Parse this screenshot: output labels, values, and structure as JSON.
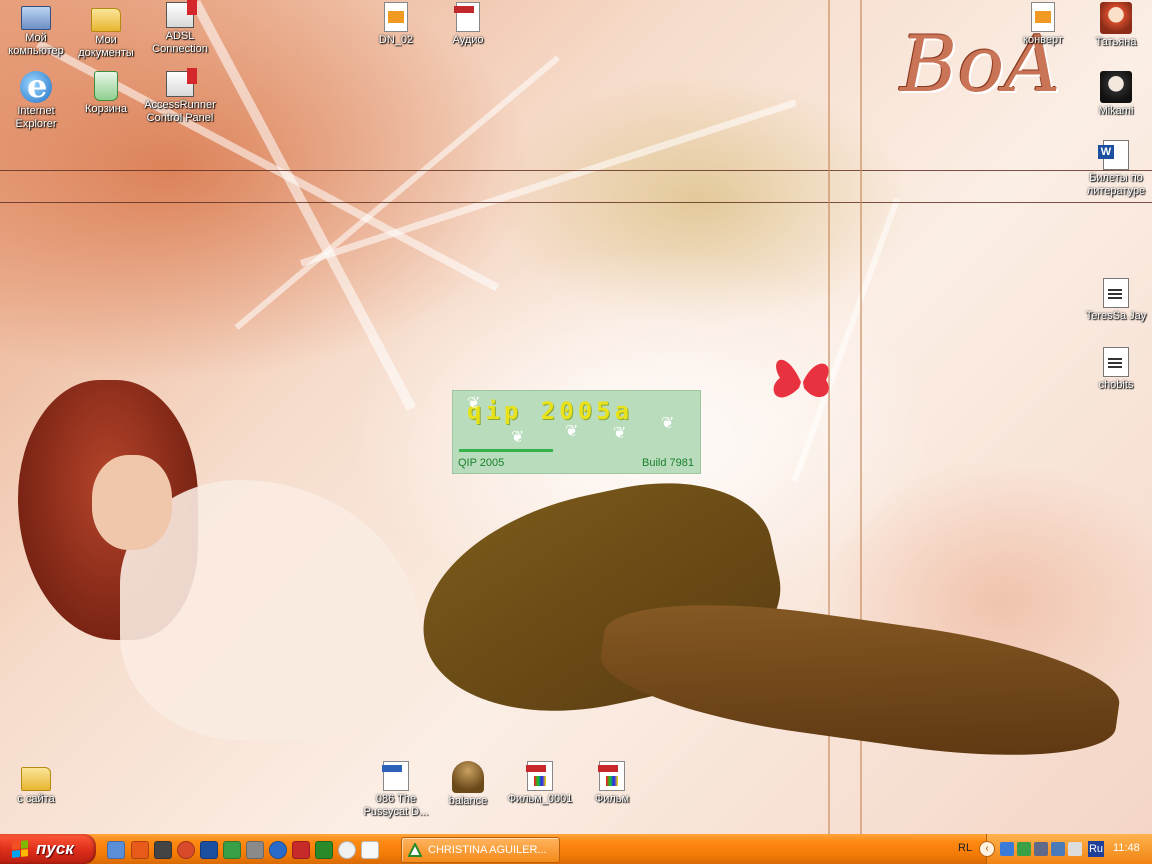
{
  "desktop": {
    "wallpaper_text": "BoA",
    "icons": {
      "my_computer": "Мой компьютер",
      "my_documents": "Мои документы",
      "adsl": "ADSL Connection",
      "ie": "Internet Explorer",
      "recycle": "Корзина",
      "accessrunner": "AccessRunner Control Panel",
      "dn02": "DN_02",
      "audio": "Аудио",
      "konvert": "конверт",
      "tatyana": "Татьяна",
      "mikami": "Mikami",
      "bilety": "Билеты по литературе",
      "teressa": "TeresSa Jay",
      "chobits": "chobits",
      "s_saita": "с сайта",
      "pussycat": "086 The Pussycat D...",
      "balance": "balance",
      "film0001": "Фильм_0001",
      "film": "Фильм"
    }
  },
  "splash": {
    "brand": "qip 2005a",
    "app_name": "QIP 2005",
    "build": "Build 7981",
    "progress_fraction": 0.38
  },
  "taskbar": {
    "start_label": "пуск",
    "task_title": "CHRISTINA AGUILER...",
    "lang_left": "RL",
    "lang": "Ru",
    "clock": "11:48"
  },
  "colors": {
    "taskbar": "#f27a06",
    "start": "#e0301c",
    "splash_bg": "#b9dcbd",
    "splash_text": "#18812b",
    "brand_yellow": "#e8e21a"
  }
}
